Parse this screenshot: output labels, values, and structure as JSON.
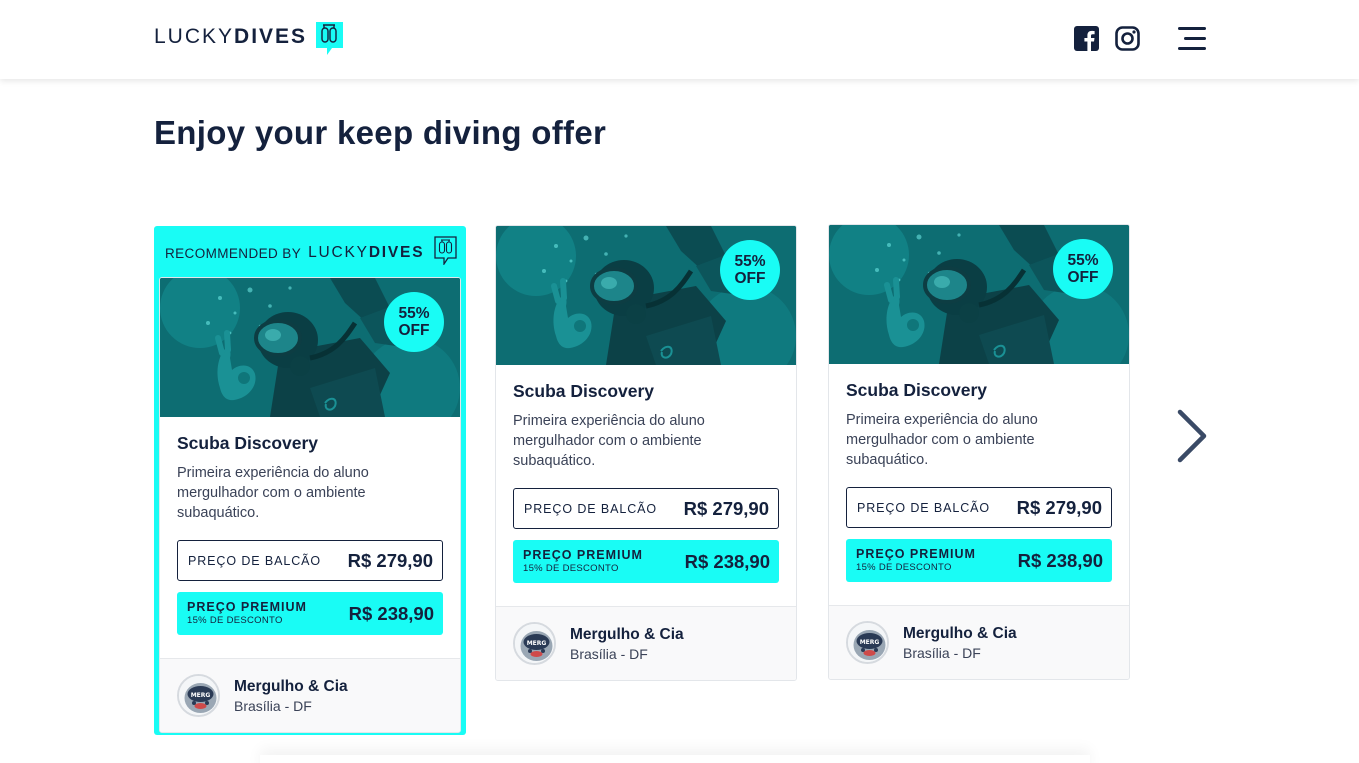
{
  "header": {
    "logo_light": "LUCKY",
    "logo_bold": "DIVES",
    "icons": [
      "facebook-icon",
      "instagram-icon",
      "hamburger-menu-icon"
    ]
  },
  "page": {
    "title": "Enjoy your keep diving offer"
  },
  "recommended": {
    "label": "RECOMMENDED BY",
    "logo_light": "LUCKY",
    "logo_bold": "DIVES"
  },
  "cards": [
    {
      "badge_pct": "55%",
      "badge_off": "OFF",
      "title": "Scuba Discovery",
      "description": "Primeira experiência do aluno mergulhador com o ambiente subaquático.",
      "price_label": "PREÇO DE BALCÃO",
      "price_value": "R$ 279,90",
      "premium_label": "PREÇO PREMIUM",
      "premium_sub": "15% DE DESCONTO",
      "premium_value": "R$ 238,90",
      "school_name": "Mergulho & Cia",
      "school_location": "Brasília - DF"
    },
    {
      "badge_pct": "55%",
      "badge_off": "OFF",
      "title": "Scuba Discovery",
      "description": "Primeira experiência do aluno mergulhador com o ambiente subaquático.",
      "price_label": "PREÇO DE BALCÃO",
      "price_value": "R$ 279,90",
      "premium_label": "PREÇO PREMIUM",
      "premium_sub": "15% DE DESCONTO",
      "premium_value": "R$ 238,90",
      "school_name": "Mergulho & Cia",
      "school_location": "Brasília - DF"
    },
    {
      "badge_pct": "55%",
      "badge_off": "OFF",
      "title": "Scuba Discovery",
      "description": "Primeira experiência do aluno mergulhador com o ambiente subaquático.",
      "price_label": "PREÇO DE BALCÃO",
      "price_value": "R$ 279,90",
      "premium_label": "PREÇO PREMIUM",
      "premium_sub": "15% DE DESCONTO",
      "premium_value": "R$ 238,90",
      "school_name": "Mergulho & Cia",
      "school_location": "Brasília - DF"
    }
  ],
  "colors": {
    "accent": "#19fcf5",
    "navy": "#14213d",
    "image_tint": "#0f6f73"
  }
}
